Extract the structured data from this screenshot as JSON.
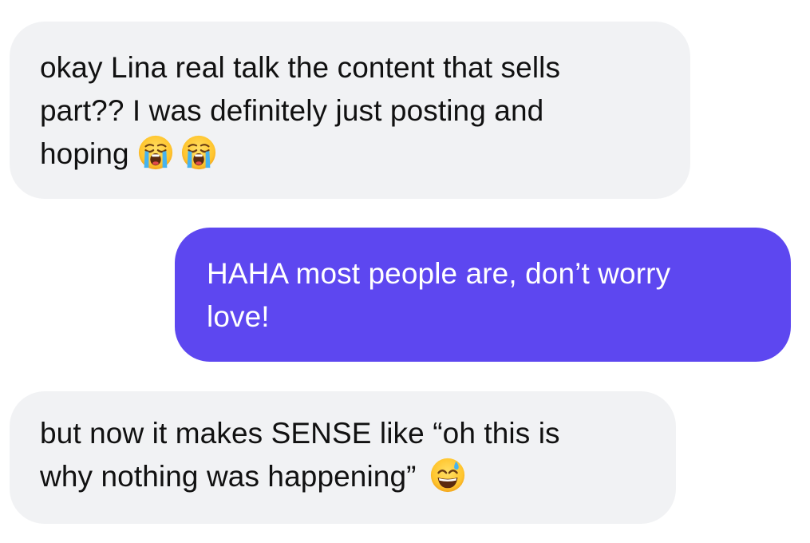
{
  "messages": [
    {
      "direction": "incoming",
      "lines": [
        "okay Lina real talk the content that sells",
        "part?? I was definitely just posting and",
        "hoping"
      ],
      "emojis": [
        "loudly-crying-face-icon",
        "loudly-crying-face-icon"
      ]
    },
    {
      "direction": "outgoing",
      "lines": [
        "HAHA most people are, don’t worry",
        "love!"
      ]
    },
    {
      "direction": "incoming",
      "lines": [
        "but now it makes SENSE like “oh this is",
        "why nothing was happening”"
      ],
      "emojis": [
        "grinning-face-with-sweat-icon"
      ]
    }
  ],
  "colors": {
    "incoming_bubble": "#f1f2f4",
    "incoming_text": "#111111",
    "outgoing_bubble": "#5d47f0",
    "outgoing_text": "#ffffff"
  }
}
